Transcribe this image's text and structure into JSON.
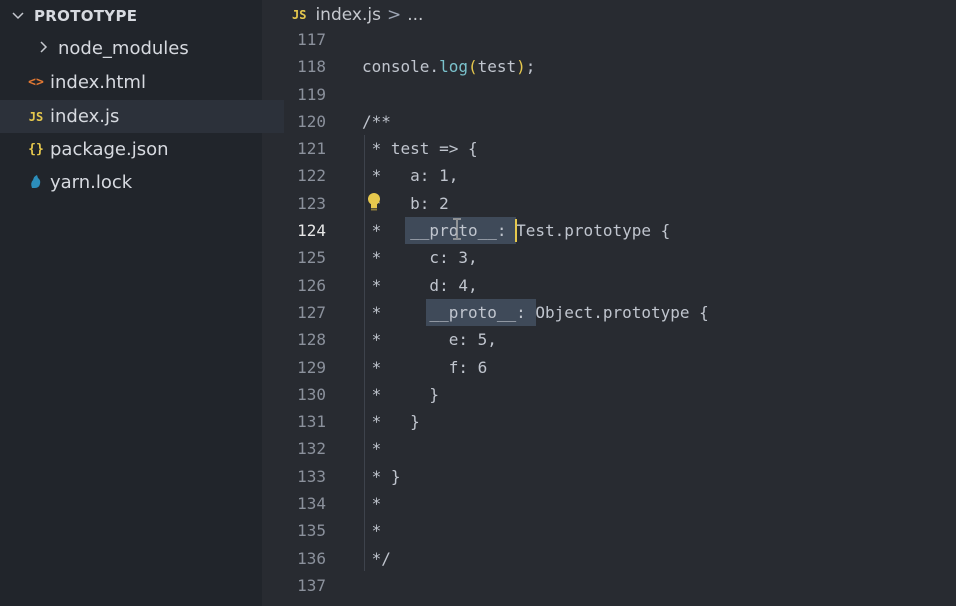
{
  "explorer": {
    "folder_name": "PROTOTYPE",
    "items": [
      {
        "label": "node_modules",
        "icon": "chevron-right-icon",
        "icon_text": ">"
      },
      {
        "label": "index.html",
        "icon": "html-file-icon",
        "icon_text": "<>"
      },
      {
        "label": "index.js",
        "icon": "js-file-icon",
        "icon_text": "JS"
      },
      {
        "label": "package.json",
        "icon": "json-file-icon",
        "icon_text": "{}"
      },
      {
        "label": "yarn.lock",
        "icon": "yarn-file-icon",
        "icon_text": "🐈"
      }
    ]
  },
  "breadcrumb": {
    "file_badge": "JS",
    "file": "index.js",
    "separator": ">",
    "more": "..."
  },
  "editor": {
    "current_line": "124",
    "line_numbers": [
      "117",
      "118",
      "119",
      "120",
      "121",
      "122",
      "123",
      "124",
      "125",
      "126",
      "127",
      "128",
      "129",
      "130",
      "131",
      "132",
      "133",
      "134",
      "135",
      "136",
      "137"
    ],
    "lines": {
      "l117": "",
      "l118_obj": "console.",
      "l118_fn": "log",
      "l118_open": "(",
      "l118_arg": "test",
      "l118_close": ")",
      "l118_end": ";",
      "l119": "",
      "l120": "/**",
      "l121": " * test => {",
      "l122": " *   a: 1,",
      "l123": " *   b: 2",
      "l124": " *   __proto__: Test.prototype {",
      "l125": " *     c: 3,",
      "l126": " *     d: 4,",
      "l127": " *     __proto__: Object.prototype {",
      "l128": " *       e: 5,",
      "l129": " *       f: 6",
      "l130": " *     }",
      "l131": " *   }",
      "l132": " *",
      "l133": " * }",
      "l134": " *",
      "l135": " *",
      "l136": " */",
      "l137": ""
    }
  },
  "colors": {
    "editor_bg": "#282b31",
    "sidebar_bg": "#21252b",
    "highlight": "#3f4a59",
    "accent_yellow": "#e6c84d"
  }
}
